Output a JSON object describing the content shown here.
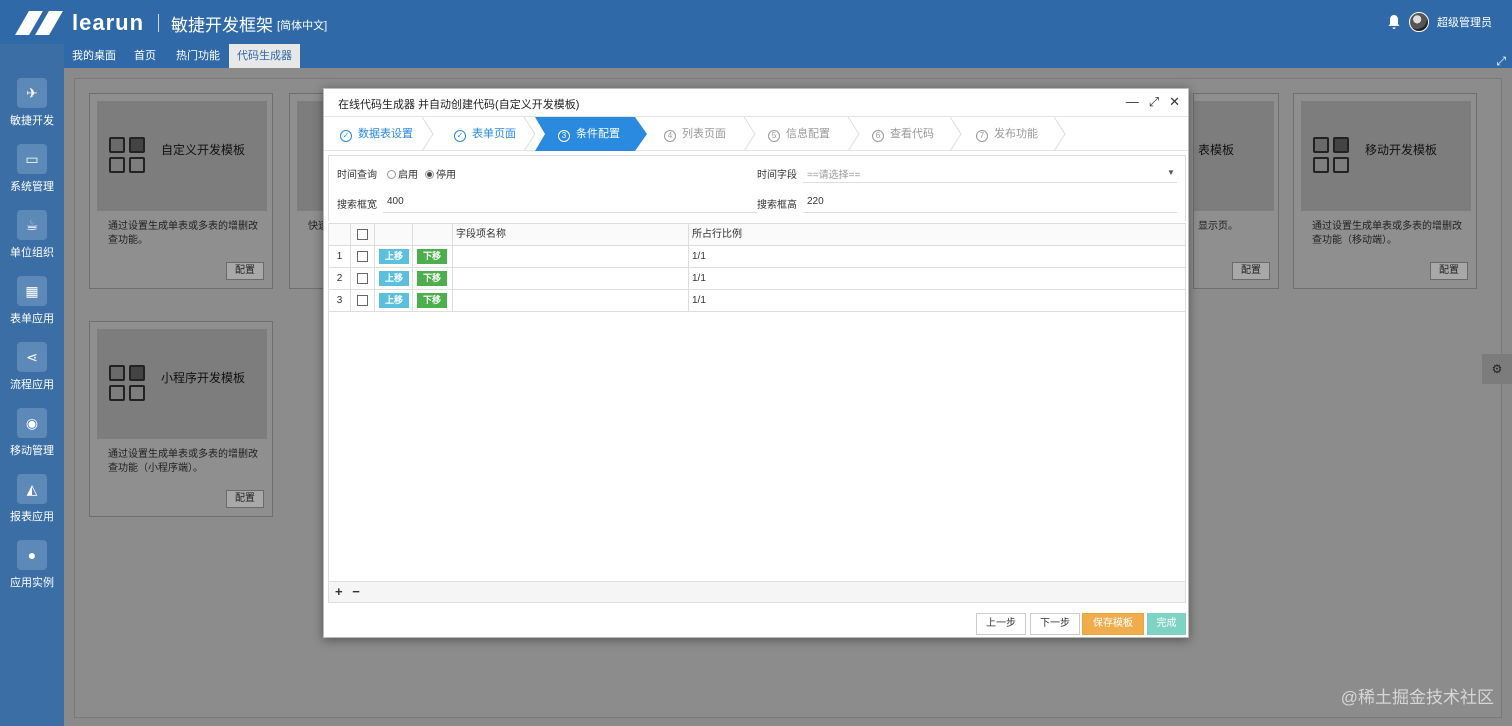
{
  "header": {
    "logo_text": "learun",
    "app_title": "敏捷开发框架",
    "lang": "[简体中文]",
    "username": "超级管理员"
  },
  "tabs": [
    {
      "label": "我的桌面"
    },
    {
      "label": "首页"
    },
    {
      "label": "热门功能"
    },
    {
      "label": "代码生成器",
      "active": true
    }
  ],
  "sidebar": {
    "items": [
      {
        "label": "敏捷开发",
        "icon": "paper-plane-icon"
      },
      {
        "label": "系统管理",
        "icon": "monitor-icon"
      },
      {
        "label": "单位组织",
        "icon": "coffee-icon"
      },
      {
        "label": "表单应用",
        "icon": "table-icon"
      },
      {
        "label": "流程应用",
        "icon": "share-icon"
      },
      {
        "label": "移动管理",
        "icon": "android-icon"
      },
      {
        "label": "报表应用",
        "icon": "area-chart-icon"
      },
      {
        "label": "应用实例",
        "icon": "globe-icon"
      }
    ]
  },
  "cards": [
    {
      "title": "自定义开发模板",
      "desc": "通过设置生成单表或多表的增删改查功能。",
      "button": "配置"
    },
    {
      "title": "",
      "desc": "快速",
      "button": ""
    },
    {
      "title": "表模板",
      "desc": "显示页。",
      "button": "配置"
    },
    {
      "title": "移动开发模板",
      "desc": "通过设置生成单表或多表的增删改查功能（移动端）。",
      "button": "配置"
    },
    {
      "title": "小程序开发模板",
      "desc": "通过设置生成单表或多表的增删改查功能（小程序端）。",
      "button": "配置"
    }
  ],
  "modal": {
    "title": "在线代码生成器 并自动创建代码(自定义开发模板)",
    "steps": [
      {
        "label": "数据表设置",
        "num": "1",
        "state": "done"
      },
      {
        "label": "表单页面",
        "num": "2",
        "state": "done"
      },
      {
        "label": "条件配置",
        "num": "3",
        "state": "active"
      },
      {
        "label": "列表页面",
        "num": "4",
        "state": "todo"
      },
      {
        "label": "信息配置",
        "num": "5",
        "state": "todo"
      },
      {
        "label": "查看代码",
        "num": "6",
        "state": "todo"
      },
      {
        "label": "发布功能",
        "num": "7",
        "state": "todo"
      }
    ],
    "form": {
      "time_query_label": "时间查询",
      "radio_enable": "启用",
      "radio_disable": "停用",
      "selected": "停用",
      "time_field_label": "时间字段",
      "time_field_placeholder": "==请选择==",
      "search_width_label": "搜索框宽",
      "search_width_value": "400",
      "search_height_label": "搜索框高",
      "search_height_value": "220"
    },
    "table": {
      "headers": [
        "字段项名称",
        "所占行比例"
      ],
      "up_label": "上移",
      "down_label": "下移",
      "rows": [
        {
          "index": "1",
          "field": "",
          "ratio": "1/1"
        },
        {
          "index": "2",
          "field": "",
          "ratio": "1/1"
        },
        {
          "index": "3",
          "field": "",
          "ratio": "1/1"
        }
      ],
      "add": "+",
      "remove": "−"
    },
    "footer": {
      "prev": "上一步",
      "next": "下一步",
      "save": "保存模板",
      "finish": "完成"
    }
  },
  "watermark": "@稀土掘金技术社区",
  "colors": {
    "header": "#2f69a8",
    "step_active": "#2a8ae0",
    "up_button": "#5bc0de",
    "down_button": "#4cae4c",
    "save_button": "#f0ad4e",
    "finish_button": "#7fd3c4"
  }
}
